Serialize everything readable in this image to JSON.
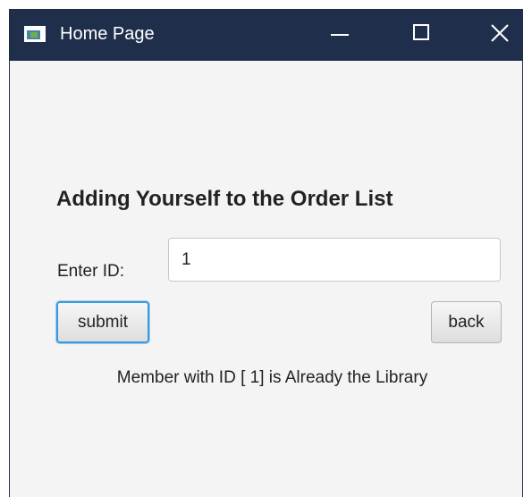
{
  "window": {
    "title": "Home Page",
    "icon": "app-window-icon",
    "controls": {
      "minimize_icon": "minimize-icon",
      "maximize_icon": "maximize-icon",
      "close_icon": "close-icon"
    }
  },
  "form": {
    "heading": "Adding Yourself to the Order List",
    "id_label": "Enter ID:",
    "id_value": "1",
    "submit_label": "submit",
    "back_label": "back",
    "status_message": "Member with ID [ 1] is Already the Library"
  },
  "colors": {
    "titlebar": "#1f2f4b",
    "background": "#f4f4f4",
    "focus_ring": "#3a9ad9"
  }
}
